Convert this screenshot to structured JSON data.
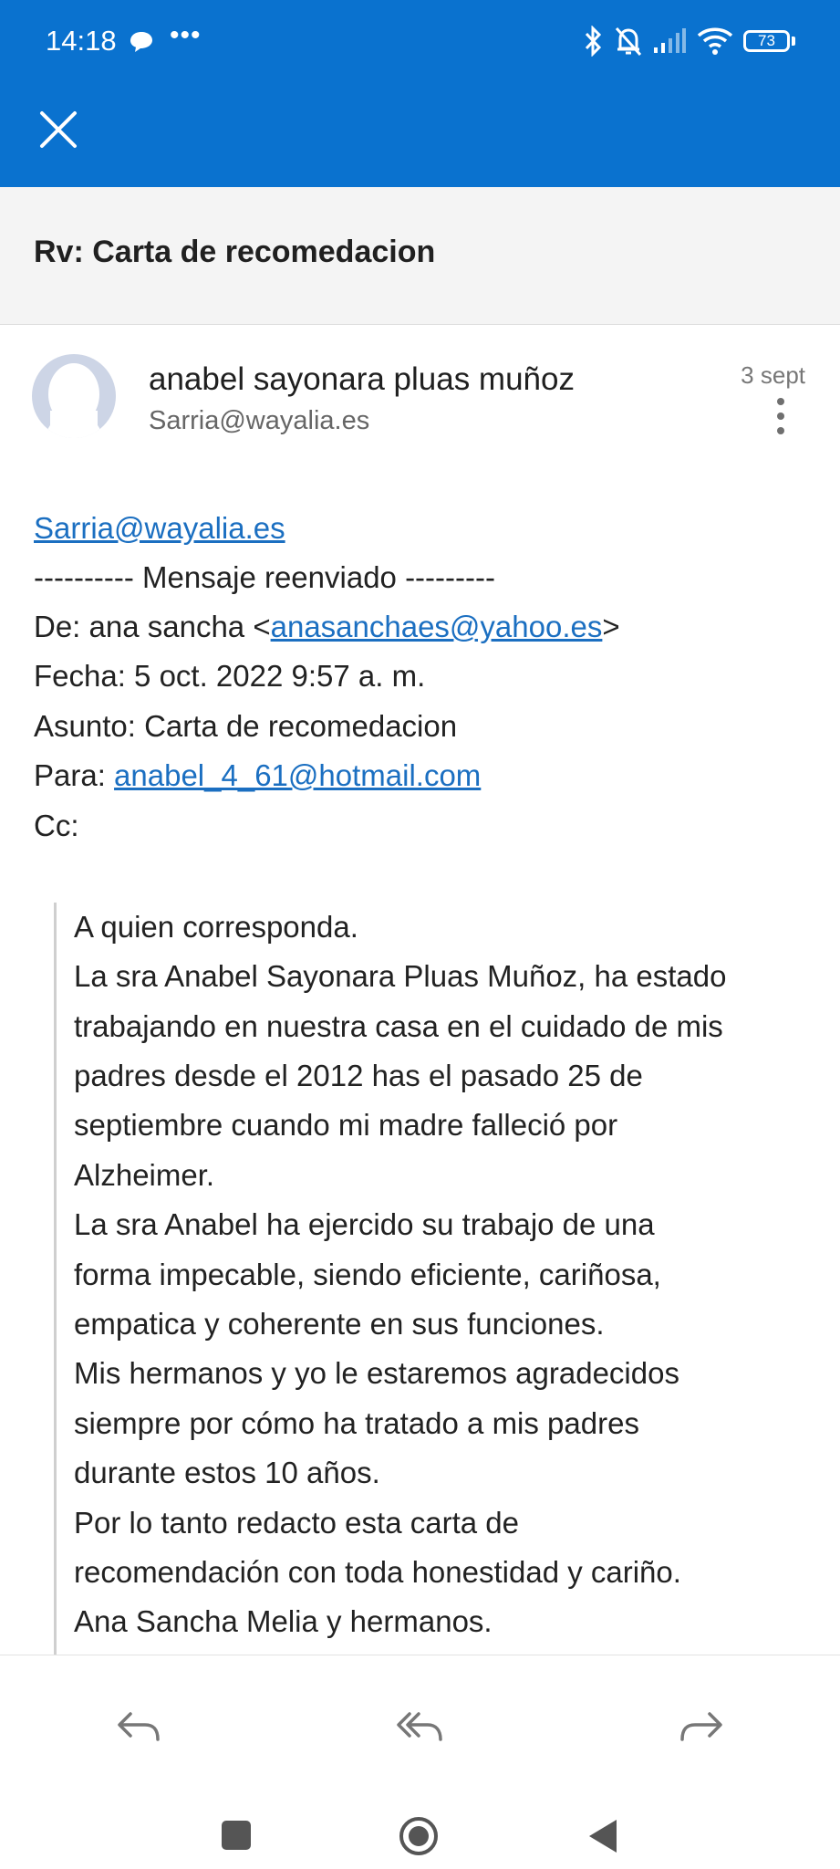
{
  "status_bar": {
    "time": "14:18",
    "battery": "73",
    "icons": [
      "chat-bubble-icon",
      "more-dots-icon",
      "bluetooth-icon",
      "bell-off-icon",
      "signal-icon",
      "wifi-icon",
      "battery-icon"
    ]
  },
  "colors": {
    "appbar": "#0a72cf",
    "link": "#1b6fc1"
  },
  "toolbar": {
    "close_icon": "close-icon"
  },
  "subject": "Rv: Carta de recomedacion",
  "sender": {
    "name": "anabel sayonara pluas muñoz",
    "email": "Sarria@wayalia.es",
    "date": "3 sept"
  },
  "body": {
    "to_link": "Sarria@wayalia.es",
    "forward_header": "---------- Mensaje reenviado ---------",
    "from_prefix": "De: ana sancha <",
    "from_email": "anasanchaes@yahoo.es",
    "from_suffix": ">",
    "date_line": "Fecha: 5 oct. 2022 9:57 a. m.",
    "subject_line": "Asunto: Carta de recomedacion",
    "to_prefix": "Para: ",
    "to_email": "anabel_4_61@hotmail.com",
    "cc_line": "Cc:",
    "quote_lines": [
      "A quien corresponda.",
      "La sra Anabel Sayonara Pluas Muñoz, ha estado",
      "trabajando en nuestra casa en el cuidado de mis",
      "padres desde el 2012 has el pasado 25 de",
      "septiembre cuando mi madre falleció por",
      "Alzheimer.",
      "La sra Anabel ha ejercido su trabajo de una",
      "forma impecable, siendo eficiente, cariñosa,",
      "empatica y coherente en sus funciones.",
      "Mis hermanos y yo le estaremos agradecidos",
      "siempre por cómo ha tratado a mis padres",
      "durante estos 10 años.",
      "Por lo tanto redacto esta carta de",
      "recomendación con toda honestidad y cariño.",
      "Ana Sancha Melia y hermanos."
    ]
  },
  "actions": [
    "reply-icon",
    "reply-all-icon",
    "forward-icon"
  ],
  "nav": [
    "recents-icon",
    "home-icon",
    "back-icon"
  ]
}
